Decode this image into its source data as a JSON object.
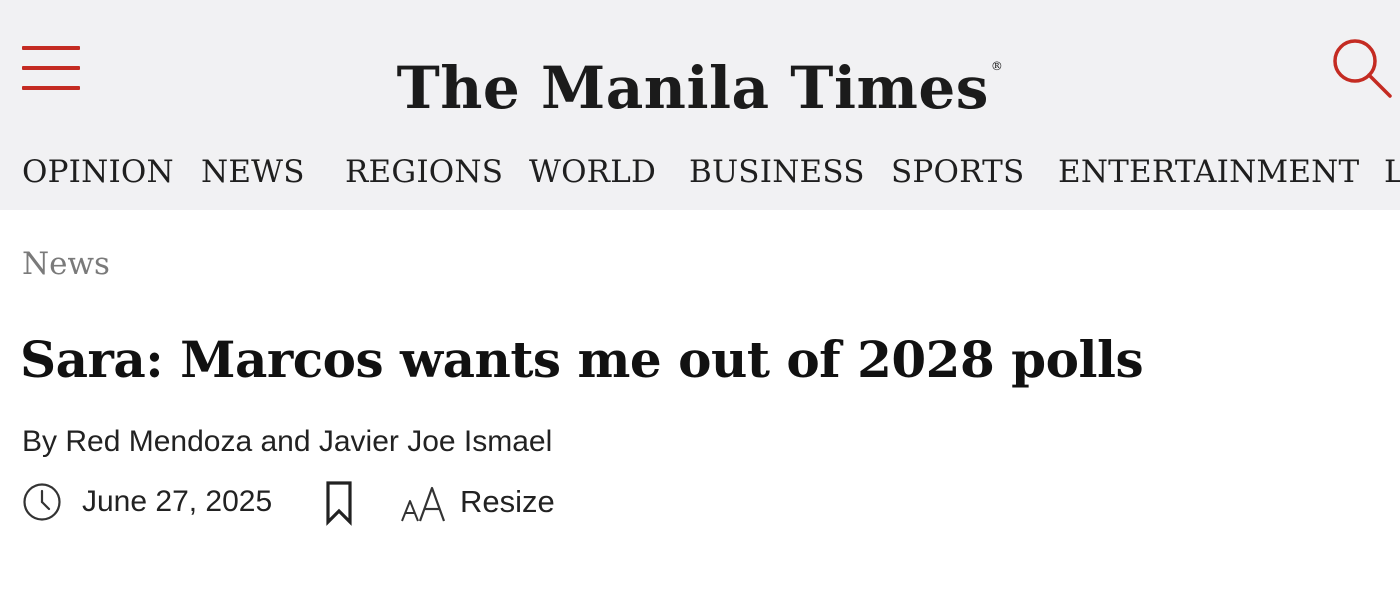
{
  "header": {
    "site_name": "The Manila Times",
    "registered_mark": "®",
    "menu_icon": "hamburger-menu-icon",
    "search_icon": "search-icon"
  },
  "nav": {
    "items": [
      "OPINION",
      "NEWS",
      "REGIONS",
      "WORLD",
      "BUSINESS",
      "SPORTS",
      "ENTERTAINMENT",
      "L"
    ]
  },
  "article": {
    "category": "News",
    "headline": "Sara: Marcos wants me out of 2028 polls",
    "byline": "By Red Mendoza and Javier Joe Ismael",
    "date": "June 27, 2025",
    "date_icon": "clock-icon",
    "bookmark_icon": "bookmark-icon",
    "resize_icon": "font-resize-icon",
    "resize_label": "Resize"
  },
  "colors": {
    "accent": "#c42b22",
    "header_bg": "#f1f1f3",
    "text": "#111111",
    "muted": "#7a7a7a"
  }
}
